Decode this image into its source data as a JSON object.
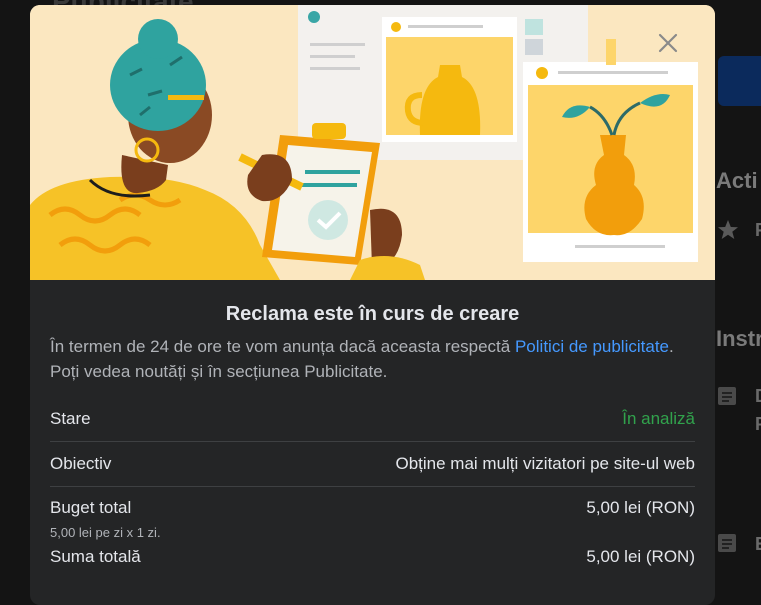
{
  "background": {
    "page_title": "Publicitate",
    "section_activity": "Acti",
    "section_instructions": "Instr"
  },
  "modal": {
    "close_icon": "close-icon",
    "title": "Reclama este în curs de creare",
    "description_before_link": "În termen de 24 de ore te vom anunța dacă aceasta respectă ",
    "description_link": "Politici de publicitate",
    "description_after_link": ". Poți vedea noutăți și în secțiunea Publicitate.",
    "rows": {
      "status_label": "Stare",
      "status_value": "În analiză",
      "objective_label": "Obiectiv",
      "objective_value": "Obține mai mulți vizitatori pe site-ul web",
      "budget_label": "Buget total",
      "budget_value": "5,00 lei (RON)",
      "budget_detail": "5,00 lei pe zi x 1 zi.",
      "total_label": "Suma totală",
      "total_value": "5,00 lei (RON)"
    }
  },
  "colors": {
    "modal_bg": "#242526",
    "link": "#4599ff",
    "status_green": "#31a24c",
    "hero_bg": "#fbe7c0"
  }
}
